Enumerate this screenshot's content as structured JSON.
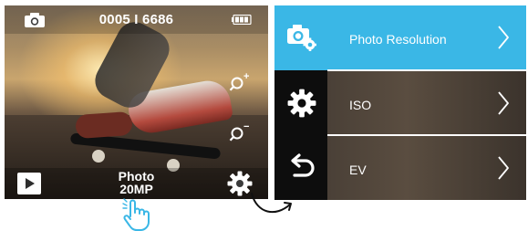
{
  "preview": {
    "counter": "0005 I 6686",
    "mode": "Photo",
    "resolution": "20MP",
    "zoom_in_symbol": "+",
    "zoom_out_symbol": "−",
    "icons": [
      "camera-icon",
      "battery-icon",
      "zoom-in-icon",
      "zoom-out-icon",
      "play-icon",
      "gear-icon"
    ]
  },
  "menu": {
    "side_buttons": [
      {
        "icon": "camera-settings-icon",
        "active": true
      },
      {
        "icon": "gear-icon",
        "active": false
      },
      {
        "icon": "back-icon",
        "active": false
      }
    ],
    "items": [
      {
        "label": "Photo Resolution",
        "active": true
      },
      {
        "label": "ISO",
        "active": false
      },
      {
        "label": "EV",
        "active": false
      }
    ]
  },
  "colors": {
    "accent": "#3ab7e6",
    "hand": "#3ab7e6"
  }
}
